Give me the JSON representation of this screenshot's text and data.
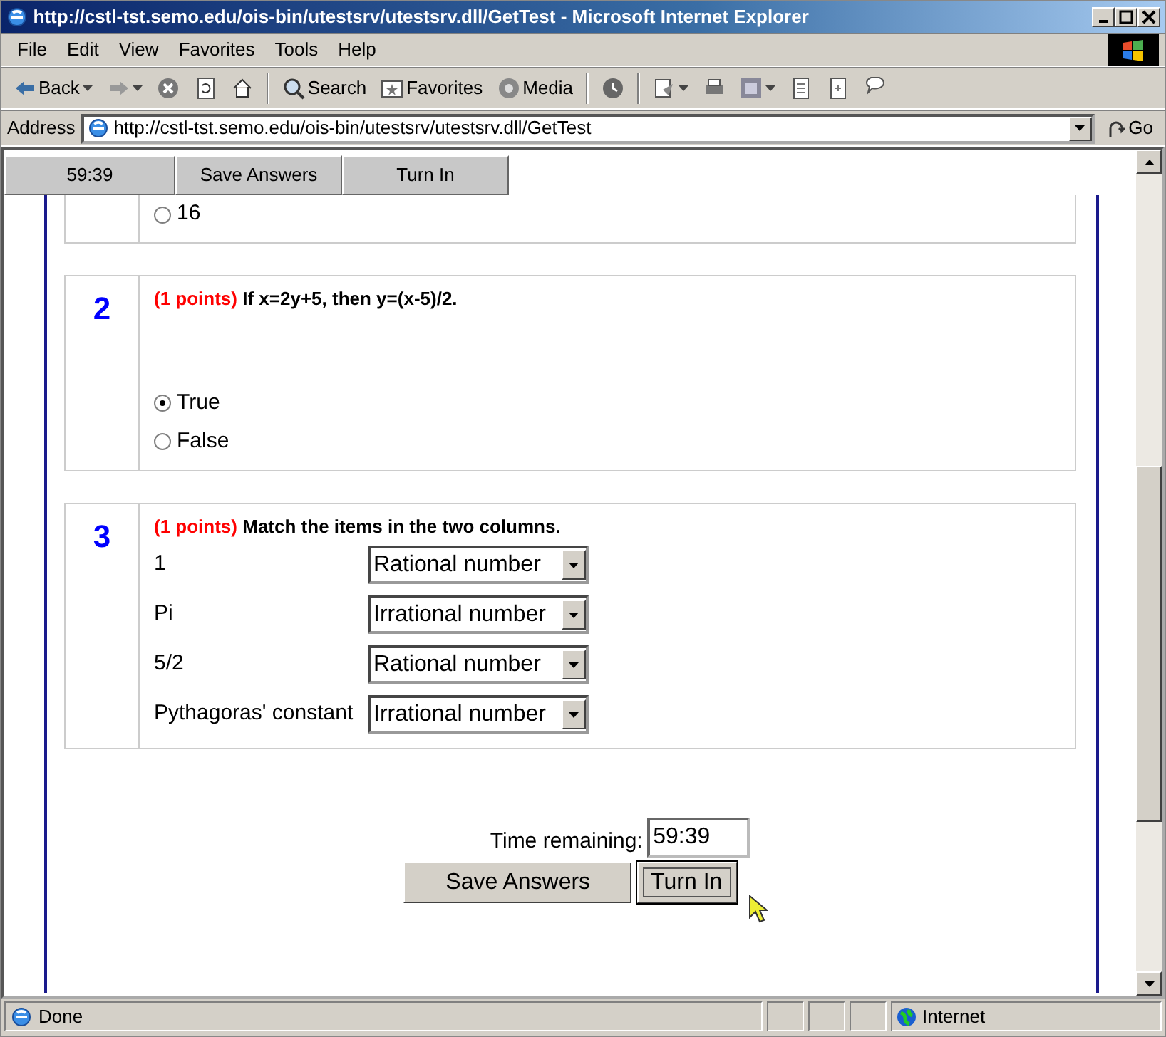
{
  "window": {
    "title": "http://cstl-tst.semo.edu/ois-bin/utestsrv/utestsrv.dll/GetTest - Microsoft Internet Explorer"
  },
  "menu": [
    "File",
    "Edit",
    "View",
    "Favorites",
    "Tools",
    "Help"
  ],
  "toolbar": [
    {
      "kind": "back",
      "label": "Back"
    },
    {
      "kind": "forward"
    },
    {
      "kind": "stop"
    },
    {
      "kind": "refresh"
    },
    {
      "kind": "home"
    },
    {
      "kind": "search",
      "label": "Search"
    },
    {
      "kind": "favorites",
      "label": "Favorites"
    },
    {
      "kind": "media",
      "label": "Media"
    },
    {
      "kind": "history"
    },
    {
      "kind": "mail"
    },
    {
      "kind": "print"
    },
    {
      "kind": "edit"
    },
    {
      "kind": "discuss"
    },
    {
      "kind": "messenger"
    },
    {
      "kind": "chat"
    }
  ],
  "address": {
    "label": "Address",
    "url": "http://cstl-tst.semo.edu/ois-bin/utestsrv/utestsrv.dll/GetTest",
    "go": "Go"
  },
  "top_bar": {
    "timer": "59:39",
    "buttons": [
      "Save Answers",
      "Turn In"
    ]
  },
  "questions": [
    {
      "kind": "radio",
      "options": [
        {
          "label": "16",
          "selected": false
        }
      ]
    },
    {
      "kind": "radio",
      "number": "2",
      "points": "(1 points)",
      "text": "If x=2y+5, then y=(x-5)/2.",
      "options": [
        {
          "label": "True",
          "selected": true
        },
        {
          "label": "False",
          "selected": false
        }
      ]
    },
    {
      "kind": "match",
      "number": "3",
      "points": "(1 points)",
      "text": "Match the items in the two columns.",
      "pairs": [
        {
          "item": "1",
          "choice": "Rational number"
        },
        {
          "item": "Pi",
          "choice": "Irrational number"
        },
        {
          "item": "5/2",
          "choice": "Rational number"
        },
        {
          "item": "Pythagoras' constant",
          "choice": "Irrational number"
        }
      ]
    }
  ],
  "footer": {
    "label": "Time remaining:",
    "value": "59:39",
    "buttons": [
      {
        "label": "Save Answers",
        "focused": false
      },
      {
        "label": "Turn In",
        "focused": true
      }
    ]
  },
  "status_bar": {
    "text": "Done",
    "zone": "Internet"
  }
}
